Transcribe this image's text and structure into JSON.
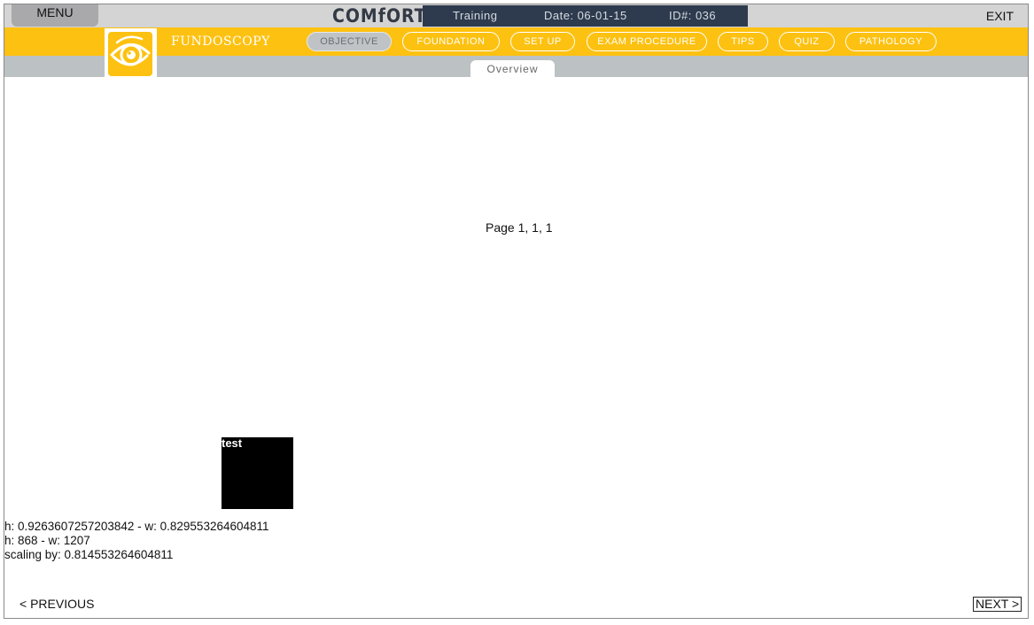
{
  "app": {
    "menu_label": "MENU",
    "brand": "COMfORT",
    "exit_label": "EXIT",
    "session": {
      "mode": "Training",
      "date": "Date: 06-01-15",
      "id": "ID#: 036"
    }
  },
  "module": {
    "title": "FUNDOSCOPY",
    "icon": "eye-icon"
  },
  "nav": {
    "tabs": [
      {
        "label": "OBJECTIVE",
        "active": true
      },
      {
        "label": "FOUNDATION",
        "active": false
      },
      {
        "label": "SET UP",
        "active": false
      },
      {
        "label": "EXAM PROCEDURE",
        "active": false
      },
      {
        "label": "TIPS",
        "active": false
      },
      {
        "label": "QUIZ",
        "active": false
      },
      {
        "label": "PATHOLOGY",
        "active": false
      }
    ]
  },
  "subnav": {
    "active_tab": "Overview"
  },
  "content": {
    "page_label": "Page 1, 1, 1",
    "test_box_label": "test",
    "debug_lines": [
      "h: 0.9263607257203842 - w: 0.829553264604811",
      "h: 868 - w: 1207",
      "scaling by: 0.814553264604811"
    ]
  },
  "footer": {
    "prev_label": "< PREVIOUS",
    "next_label": "NEXT >"
  },
  "colors": {
    "accent_yellow": "#fdc111",
    "session_navy": "#2e3b4e",
    "subbar_gray": "#bcc1c4",
    "topbar_gray": "#d4d4d4"
  }
}
